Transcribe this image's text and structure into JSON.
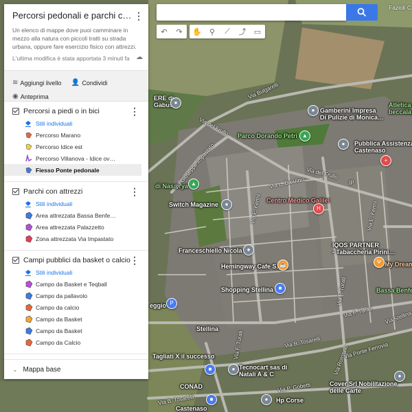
{
  "panel": {
    "title": "Percorsi pedonali e parchi con att…",
    "description": "Un elenco di mappe dove puoi camminare in mezzo alla natura con piccoli tratti su strada urbana, oppure fare esercizio fisico con attrezzi.",
    "last_edit": "L'ultima modifica è stata apportata 3 minuti fa",
    "actions": {
      "add_layer": "Aggiungi livello",
      "share": "Condividi",
      "preview": "Anteprima"
    },
    "layers": [
      {
        "title": "Percorsi a piedi o in bici",
        "style_label": "Stili individuali",
        "features": [
          {
            "label": "Percorso Marano",
            "color": "#e8663b",
            "icon": "path-icon"
          },
          {
            "label": "Percorso Idice est",
            "color": "#f5d23a",
            "icon": "path-icon"
          },
          {
            "label": "Percorso Villanova - Idice ov…",
            "color": "#9c4fd6",
            "icon": "line-icon"
          },
          {
            "label": "Fiesso Ponte pedonale",
            "color": "#3d7be0",
            "icon": "path-icon"
          }
        ]
      },
      {
        "title": "Parchi con attrezzi",
        "style_label": "Stili individuali",
        "features": [
          {
            "label": "Area attrezzata Bassa Benfe…",
            "color": "#3d7be0",
            "icon": "area-icon"
          },
          {
            "label": "Area attrezzata Palazzetto",
            "color": "#b74fd6",
            "icon": "area-icon"
          },
          {
            "label": "Zona attrezzata Via Impastato",
            "color": "#e0405a",
            "icon": "area-icon"
          }
        ]
      },
      {
        "title": "Campi pubblici da basket o calcio",
        "style_label": "Stili individuali",
        "features": [
          {
            "label": "Campo da Basket e Teqball",
            "color": "#b74fd6",
            "icon": "area-icon"
          },
          {
            "label": "Campo da pallavolo",
            "color": "#3d7be0",
            "icon": "area-icon"
          },
          {
            "label": "Campo da calcio",
            "color": "#e8663b",
            "icon": "area-icon"
          },
          {
            "label": "Campo da Basket",
            "color": "#f0a830",
            "icon": "area-icon"
          },
          {
            "label": "Campo da Basket",
            "color": "#3d7be0",
            "icon": "area-icon"
          },
          {
            "label": "Campo da Calcio",
            "color": "#e8663b",
            "icon": "area-icon"
          }
        ]
      }
    ],
    "basemap_label": "Mappa base"
  },
  "map": {
    "corner_label": "Fazioli C",
    "pois": [
      {
        "label": "Gamberini Impresa\nDi Pulizie di Monica…",
        "type": "gray"
      },
      {
        "label": "Parco Dorando Petri",
        "type": "green"
      },
      {
        "label": "Pubblica Assistenza\nCastenaso",
        "type": "red"
      },
      {
        "label": "Atletica C\nbeccala…",
        "type": "green"
      },
      {
        "label": "di Nassirya",
        "type": "green"
      },
      {
        "label": "Switch Magazine",
        "type": "gray"
      },
      {
        "label": "Centro Medico Galilei",
        "type": "red"
      },
      {
        "label": "IQOS PARTNER\n- Tabaccheria Pirini…",
        "type": "gray"
      },
      {
        "label": "My Dream",
        "type": "orange"
      },
      {
        "label": "Franceschiello Nicola",
        "type": "gray"
      },
      {
        "label": "Hemingway Cafe S.R.L",
        "type": "orange"
      },
      {
        "label": "Shopping Stellina",
        "type": "gray"
      },
      {
        "label": "Bassa Benfenati",
        "type": "green"
      },
      {
        "label": "Tagliati X il successo",
        "type": "gray"
      },
      {
        "label": "Tecnocart sas di\nNatali A & C",
        "type": "gray"
      },
      {
        "label": "Cover Srl Nobilitazione\ndelle Carte",
        "type": "gray"
      },
      {
        "label": "CONAD",
        "type": "gray"
      },
      {
        "label": "Hp Corse",
        "type": "gray"
      },
      {
        "label": "Castenaso",
        "type": "gray"
      },
      {
        "label": "ERE di\nGabusi",
        "type": "gray"
      },
      {
        "label": "Stellina",
        "type": "gray"
      },
      {
        "label": "eggio",
        "type": "gray"
      }
    ],
    "roads": [
      "Via Bulgarelli",
      "Via del Frullo",
      "Via Giuseppe Impastato",
      "Via L. Da Vinci",
      "Via del Frullo",
      "Via E. Fermi",
      "Via E. Fermi",
      "Via F. Turati",
      "Via F. Turati",
      "Via F. Turati",
      "Via B. Tosarelli",
      "Via B. Tosarelli",
      "Via Romitino",
      "Via Ponte Ferrovia",
      "Via P. Gobetti",
      "Via Stellina",
      "IP"
    ]
  }
}
